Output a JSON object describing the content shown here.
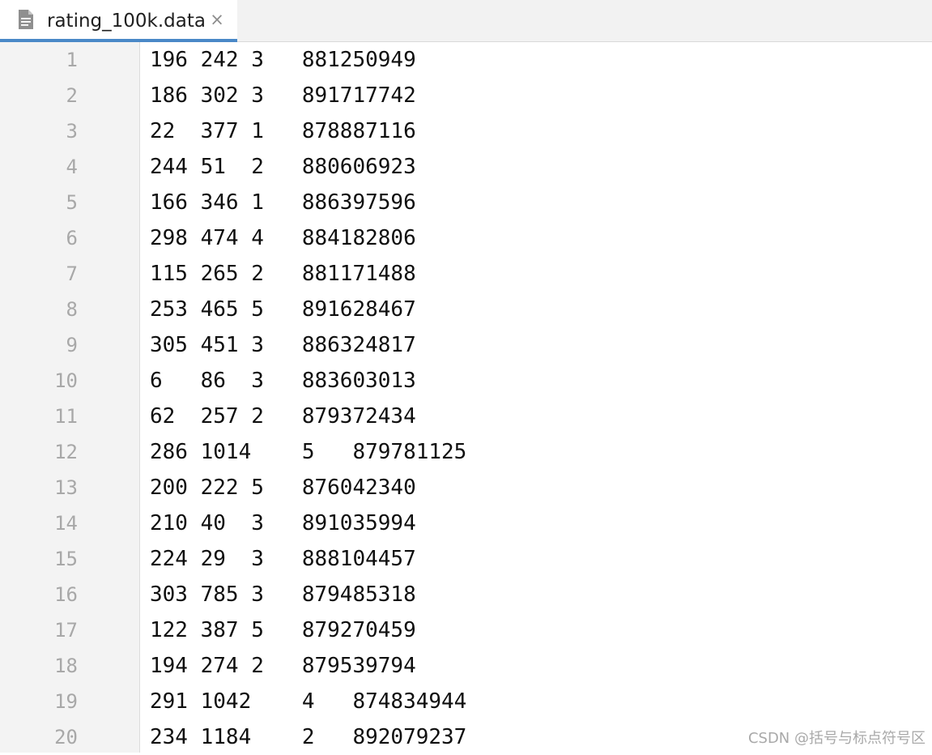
{
  "tab": {
    "icon": "text-file-icon",
    "title": "rating_100k.data",
    "close_glyph": "×"
  },
  "lines": [
    {
      "no": "1",
      "text": "196 242 3   881250949"
    },
    {
      "no": "2",
      "text": "186 302 3   891717742"
    },
    {
      "no": "3",
      "text": "22  377 1   878887116"
    },
    {
      "no": "4",
      "text": "244 51  2   880606923"
    },
    {
      "no": "5",
      "text": "166 346 1   886397596"
    },
    {
      "no": "6",
      "text": "298 474 4   884182806"
    },
    {
      "no": "7",
      "text": "115 265 2   881171488"
    },
    {
      "no": "8",
      "text": "253 465 5   891628467"
    },
    {
      "no": "9",
      "text": "305 451 3   886324817"
    },
    {
      "no": "10",
      "text": "6   86  3   883603013"
    },
    {
      "no": "11",
      "text": "62  257 2   879372434"
    },
    {
      "no": "12",
      "text": "286 1014    5   879781125"
    },
    {
      "no": "13",
      "text": "200 222 5   876042340"
    },
    {
      "no": "14",
      "text": "210 40  3   891035994"
    },
    {
      "no": "15",
      "text": "224 29  3   888104457"
    },
    {
      "no": "16",
      "text": "303 785 3   879485318"
    },
    {
      "no": "17",
      "text": "122 387 5   879270459"
    },
    {
      "no": "18",
      "text": "194 274 2   879539794"
    },
    {
      "no": "19",
      "text": "291 1042    4   874834944"
    },
    {
      "no": "20",
      "text": "234 1184    2   892079237"
    }
  ],
  "watermark": "CSDN @括号与标点符号区",
  "colors": {
    "tab_underline": "#4a88c7",
    "gutter_bg": "#f3f3f3",
    "line_number": "#a8a8a8",
    "text": "#0f0f0f"
  }
}
